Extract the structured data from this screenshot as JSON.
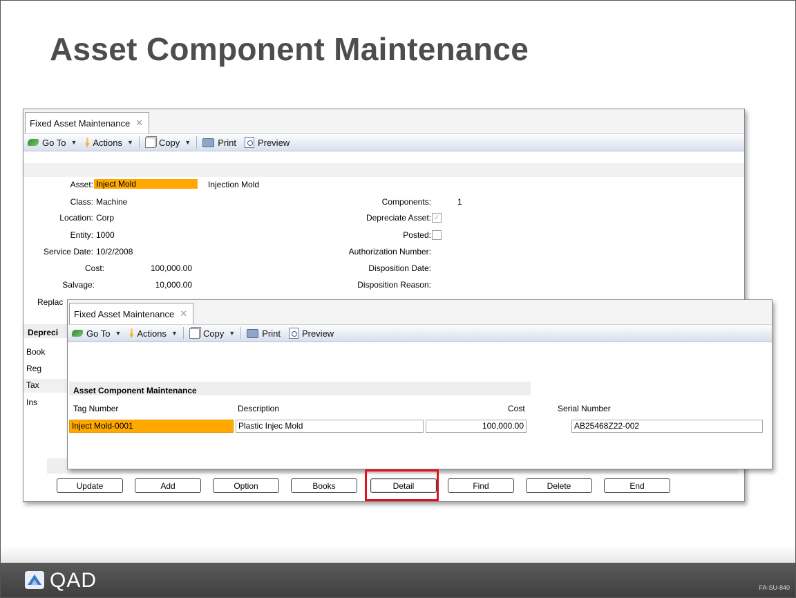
{
  "slide": {
    "title": "Asset Component Maintenance",
    "code": "FA-SU-840",
    "logo_text": "QAD"
  },
  "window_back": {
    "tab_label": "Fixed Asset Maintenance",
    "toolbar": {
      "goto": "Go To",
      "actions": "Actions",
      "copy": "Copy",
      "print": "Print",
      "preview": "Preview"
    },
    "fields_left": [
      {
        "label": "Asset:",
        "value": "Inject Mold"
      },
      {
        "label": "Class:",
        "value": "Machine"
      },
      {
        "label": "Location:",
        "value": "Corp"
      },
      {
        "label": "Entity:",
        "value": "1000"
      },
      {
        "label": "Service Date:",
        "value": "10/2/2008"
      },
      {
        "label": "Cost:",
        "value": "100,000.00"
      },
      {
        "label": "Salvage:",
        "value": "10,000.00"
      },
      {
        "label": "Replac",
        "value": ""
      }
    ],
    "asset_description": "Injection Mold",
    "fields_right": [
      {
        "label": "Components:",
        "value": "1"
      },
      {
        "label": "Depreciate Asset:",
        "value": ""
      },
      {
        "label": "Posted:",
        "value": ""
      },
      {
        "label": "Authorization Number:",
        "value": ""
      },
      {
        "label": "Disposition Date:",
        "value": ""
      },
      {
        "label": "Disposition Reason:",
        "value": ""
      }
    ],
    "depreciation_header": "Depreci",
    "books": [
      "Book",
      "Reg",
      "Tax",
      "Ins"
    ],
    "buttons": [
      "Update",
      "Add",
      "Option",
      "Books",
      "Detail",
      "Find",
      "Delete",
      "End"
    ]
  },
  "window_front": {
    "tab_label": "Fixed Asset Maintenance",
    "toolbar": {
      "goto": "Go To",
      "actions": "Actions",
      "copy": "Copy",
      "print": "Print",
      "preview": "Preview"
    },
    "section_title": "Asset Component Maintenance",
    "columns": [
      "Tag Number",
      "Description",
      "Cost",
      "Serial Number"
    ],
    "row": {
      "tag_number": "Inject Mold-0001",
      "description": "Plastic Injec Mold",
      "cost": "100,000.00",
      "serial_number": "AB25468Z22-002"
    }
  },
  "colors": {
    "highlight": "#ffa800",
    "focus_ring": "#e0101c",
    "footer": "#4a4a4a"
  },
  "icons": [
    "goto-icon",
    "actions-icon",
    "copy-icon",
    "print-icon",
    "preview-icon",
    "close-icon",
    "qad-logo-icon"
  ]
}
